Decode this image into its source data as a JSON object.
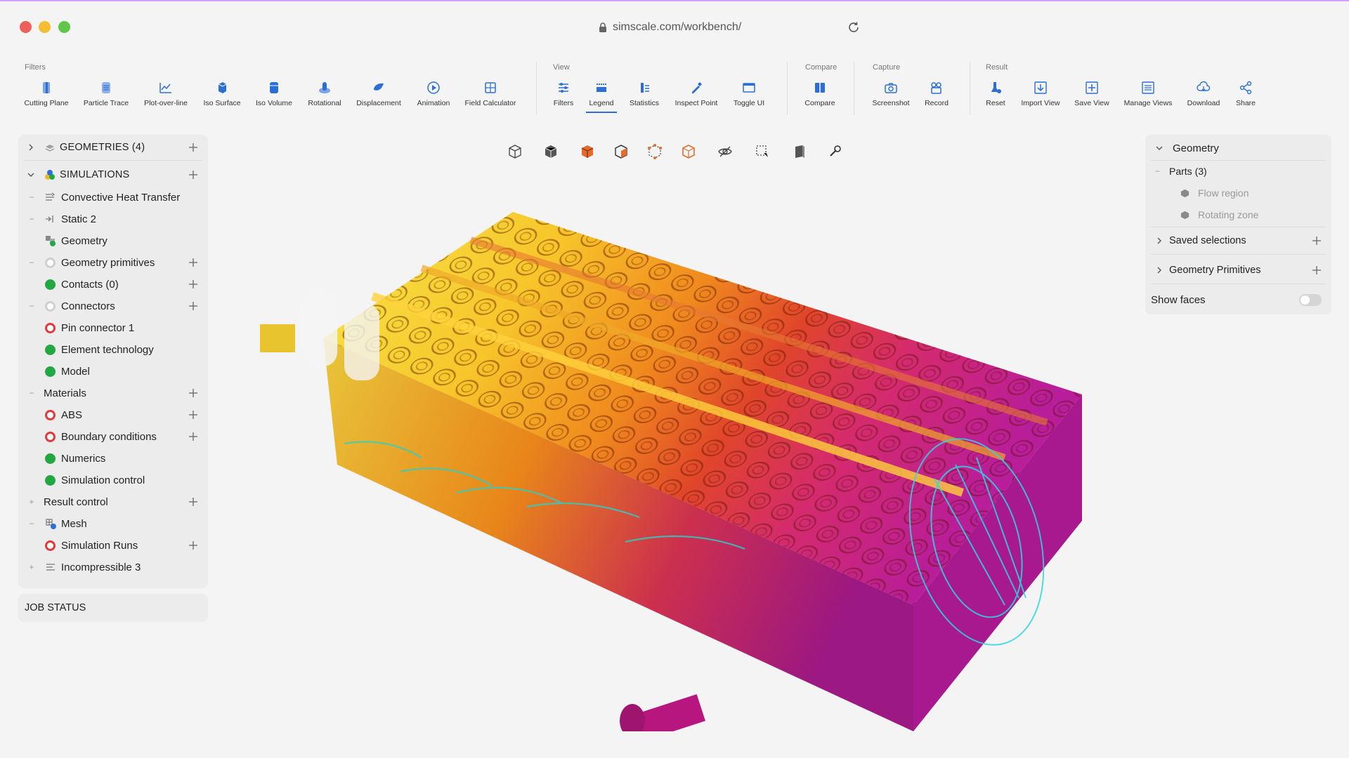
{
  "browser": {
    "url": "simscale.com/workbench/"
  },
  "toolbar": {
    "groups": {
      "filters": "Filters",
      "view": "View",
      "compare": "Compare",
      "capture": "Capture",
      "result": "Result"
    },
    "tools": {
      "cutting_plane": "Cutting Plane",
      "particle_trace": "Particle Trace",
      "plot_over_line": "Plot-over-line",
      "iso_surface": "Iso Surface",
      "iso_volume": "Iso Volume",
      "rotational": "Rotational",
      "displacement": "Displacement",
      "animation": "Animation",
      "field_calculator": "Field Calculator",
      "filters": "Filters",
      "legend": "Legend",
      "statistics": "Statistics",
      "inspect_point": "Inspect Point",
      "toggle_ui": "Toggle UI",
      "compare": "Compare",
      "screenshot": "Screenshot",
      "record": "Record",
      "reset": "Reset",
      "import_view": "Import View",
      "save_view": "Save View",
      "manage_views": "Manage Views",
      "download": "Download",
      "share": "Share"
    },
    "active_tool": "Legend",
    "accent": "#2b6fd6"
  },
  "left_panel": {
    "geometries": "GEOMETRIES (4)",
    "simulations": "SIMULATIONS",
    "items": {
      "convective": "Convective Heat Transfer",
      "static2": "Static 2",
      "geometry": "Geometry",
      "geom_primitives": "Geometry primitives",
      "contacts": "Contacts (0)",
      "connectors": "Connectors",
      "pin_connector": "Pin connector 1",
      "element_tech": "Element technology",
      "model": "Model",
      "materials": "Materials",
      "abs": "ABS",
      "boundary": "Boundary conditions",
      "numerics": "Numerics",
      "sim_control": "Simulation control",
      "result_control": "Result control",
      "mesh": "Mesh",
      "sim_runs": "Simulation Runs",
      "incompressible": "Incompressible 3"
    },
    "job_status": "JOB STATUS"
  },
  "right_panel": {
    "geometry": "Geometry",
    "parts": "Parts (3)",
    "flow_region": "Flow region",
    "rotating_zone": "Rotating zone",
    "saved_selections": "Saved selections",
    "geometry_primitives": "Geometry Primitives",
    "show_faces": "Show faces",
    "show_faces_on": false
  },
  "status_colors": {
    "ok": "#21a843",
    "error": "#e03a3a",
    "pending": "#cfcfcf"
  }
}
